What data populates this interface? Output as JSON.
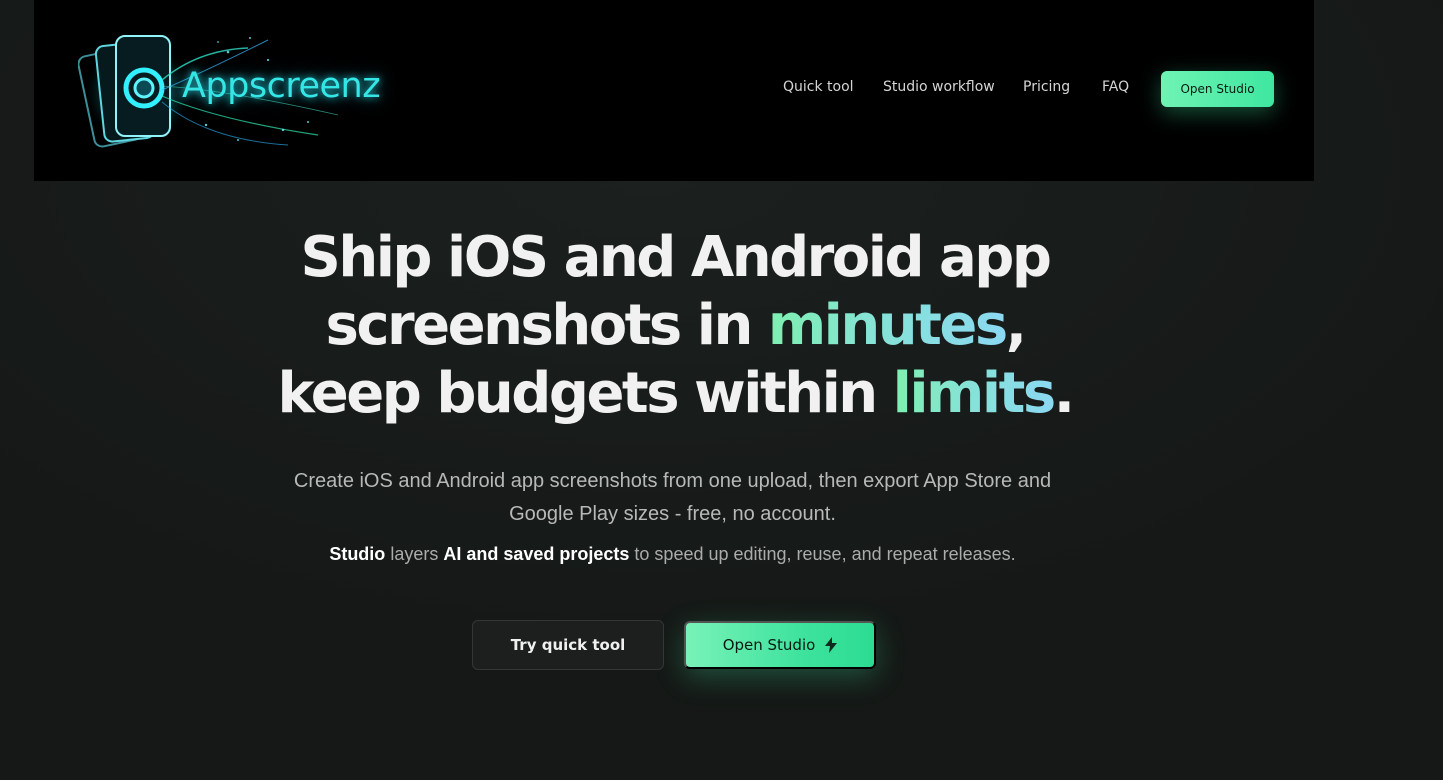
{
  "header": {
    "logo_text": "Appscreenz",
    "nav": [
      {
        "label": "Quick tool"
      },
      {
        "label": "Studio workflow"
      },
      {
        "label": "Pricing"
      },
      {
        "label": "FAQ"
      }
    ],
    "cta_label": "Open Studio"
  },
  "hero": {
    "line1": "Ship iOS and Android app",
    "line2_pre": "screenshots in ",
    "line2_accent": "minutes",
    "line2_post": ",",
    "line3_pre": "keep budgets within ",
    "line3_accent": "limits",
    "line3_post": ".",
    "subtitle": "Create iOS and Android app screenshots from one upload, then export App Store and Google Play sizes - free, no account.",
    "sub2": {
      "studio": "Studio",
      "layers": " layers ",
      "ai": "AI and saved projects",
      "rest": " to speed up editing, reuse, and repeat releases."
    },
    "btn_quick": "Try quick tool",
    "btn_open": "Open Studio"
  },
  "icons": {
    "bolt": "bolt-icon",
    "logo": "phone-swirl-logo-icon"
  },
  "colors": {
    "accent": "#3ee7a0",
    "logo_glow": "#35e6e6",
    "background": "#171b19"
  }
}
